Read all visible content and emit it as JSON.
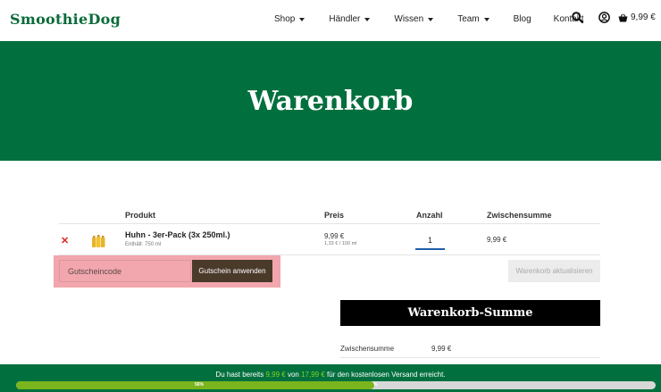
{
  "brand": {
    "logo": "SmoothieDog",
    "accent": "#02703e"
  },
  "nav": {
    "items": [
      {
        "label": "Shop",
        "dropdown": true
      },
      {
        "label": "Händler",
        "dropdown": true
      },
      {
        "label": "Wissen",
        "dropdown": true
      },
      {
        "label": "Team",
        "dropdown": true
      },
      {
        "label": "Blog",
        "dropdown": false
      },
      {
        "label": "Kontakt",
        "dropdown": false
      }
    ],
    "cart_total": "9,99 €"
  },
  "hero": {
    "title": "Warenkorb"
  },
  "cart": {
    "headers": {
      "product": "Produkt",
      "price": "Preis",
      "quantity": "Anzahl",
      "subtotal": "Zwischensumme"
    },
    "items": [
      {
        "name": "Huhn - 3er-Pack (3x 250ml.)",
        "meta": "Enthält: 750 ml",
        "price": "9,99 €",
        "unit_price": "1,33 € / 100 ml",
        "quantity": "1",
        "subtotal": "9,99 €"
      }
    ],
    "coupon_placeholder": "Gutscheincode",
    "coupon_button": "Gutschein anwenden",
    "update_button": "Warenkorb aktualisieren"
  },
  "totals": {
    "title": "Warenkorb-Summe",
    "subtotal_label": "Zwischensumme",
    "subtotal_value": "9,99 €"
  },
  "shipping_bar": {
    "text_prefix": "Du hast bereits",
    "current": "9,99 €",
    "text_mid": "von",
    "threshold": "17,99 €",
    "text_suffix": "für den kostenlosen Versand erreicht.",
    "progress_percent": 56,
    "progress_label": "56%",
    "knob_label": "%"
  }
}
